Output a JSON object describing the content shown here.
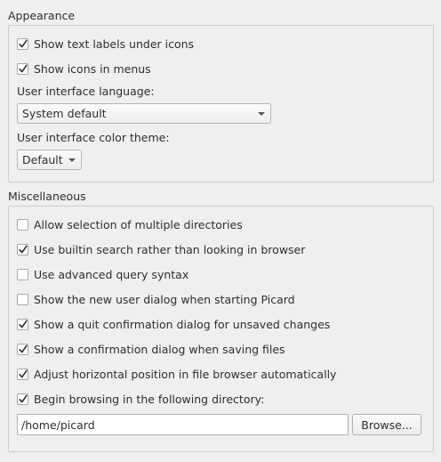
{
  "appearance": {
    "title": "Appearance",
    "show_text_labels": {
      "label": "Show text labels under icons",
      "checked": true
    },
    "show_icons_menus": {
      "label": "Show icons in menus",
      "checked": true
    },
    "language_label": "User interface language:",
    "language_value": "System default",
    "theme_label": "User interface color theme:",
    "theme_value": "Default"
  },
  "misc": {
    "title": "Miscellaneous",
    "options": [
      {
        "label": "Allow selection of multiple directories",
        "checked": false
      },
      {
        "label": "Use builtin search rather than looking in browser",
        "checked": true
      },
      {
        "label": "Use advanced query syntax",
        "checked": false
      },
      {
        "label": "Show the new user dialog when starting Picard",
        "checked": false
      },
      {
        "label": "Show a quit confirmation dialog for unsaved changes",
        "checked": true
      },
      {
        "label": "Show a confirmation dialog when saving files",
        "checked": true
      },
      {
        "label": "Adjust horizontal position in file browser automatically",
        "checked": true
      },
      {
        "label": "Begin browsing in the following directory:",
        "checked": true
      }
    ],
    "directory_value": "/home/picard",
    "browse_label": "Browse..."
  }
}
